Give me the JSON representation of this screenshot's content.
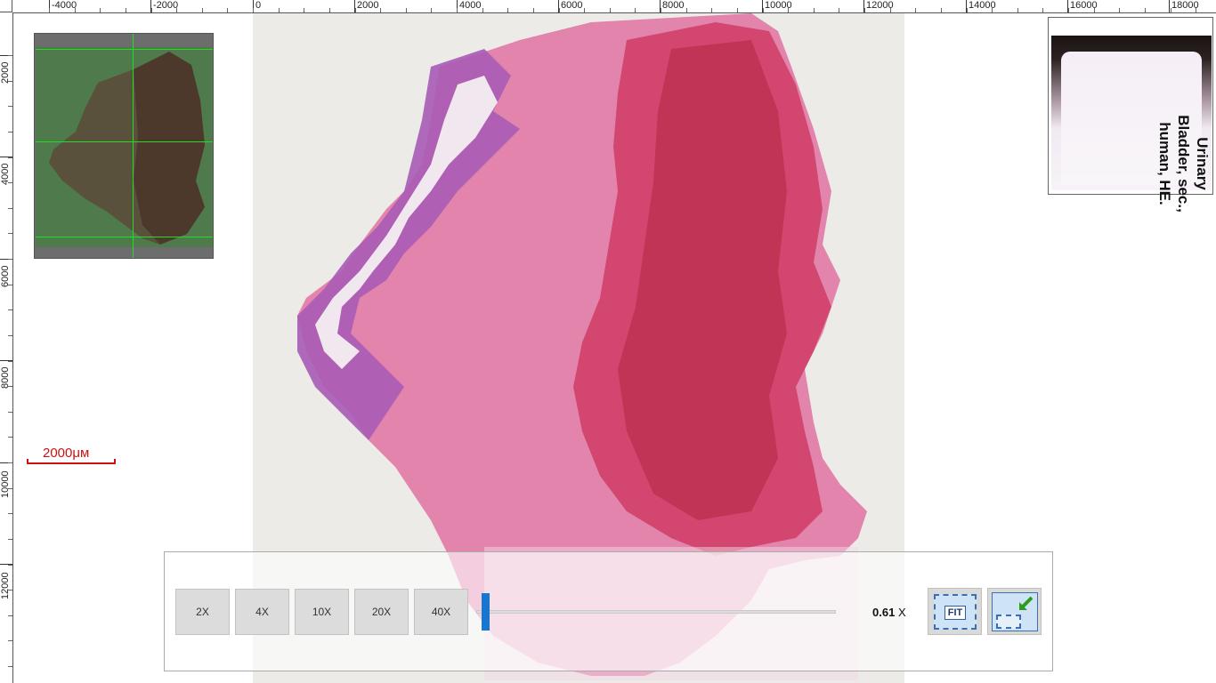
{
  "ruler_top": {
    "labels": [
      "-4000",
      "-2000",
      "0",
      "2000",
      "4000",
      "6000",
      "8000",
      "10000",
      "12000",
      "14000",
      "16000",
      "18000"
    ]
  },
  "ruler_left": {
    "labels": [
      "2000",
      "4000",
      "6000",
      "8000",
      "10000",
      "12000"
    ]
  },
  "overview": {
    "icon": "slide-overview-thumbnail"
  },
  "label_thumbnail": {
    "lines": [
      "Urinary",
      "Bladder, sec.,",
      "human, HE."
    ]
  },
  "scale_bar": {
    "label": "2000μм",
    "color": "#cc1111"
  },
  "zoom_panel": {
    "buttons": [
      "2X",
      "4X",
      "10X",
      "20X",
      "40X"
    ],
    "slider_level": 0.01,
    "zoom_value": "0.61",
    "zoom_unit": "X",
    "fit_label": "FIT",
    "accent_color": "#1577cf"
  },
  "colors": {
    "tissue_pink": "#e8749e",
    "tissue_red": "#c8365a",
    "tissue_purple": "#9a4ca8",
    "slide_background": "#ecebe8"
  }
}
